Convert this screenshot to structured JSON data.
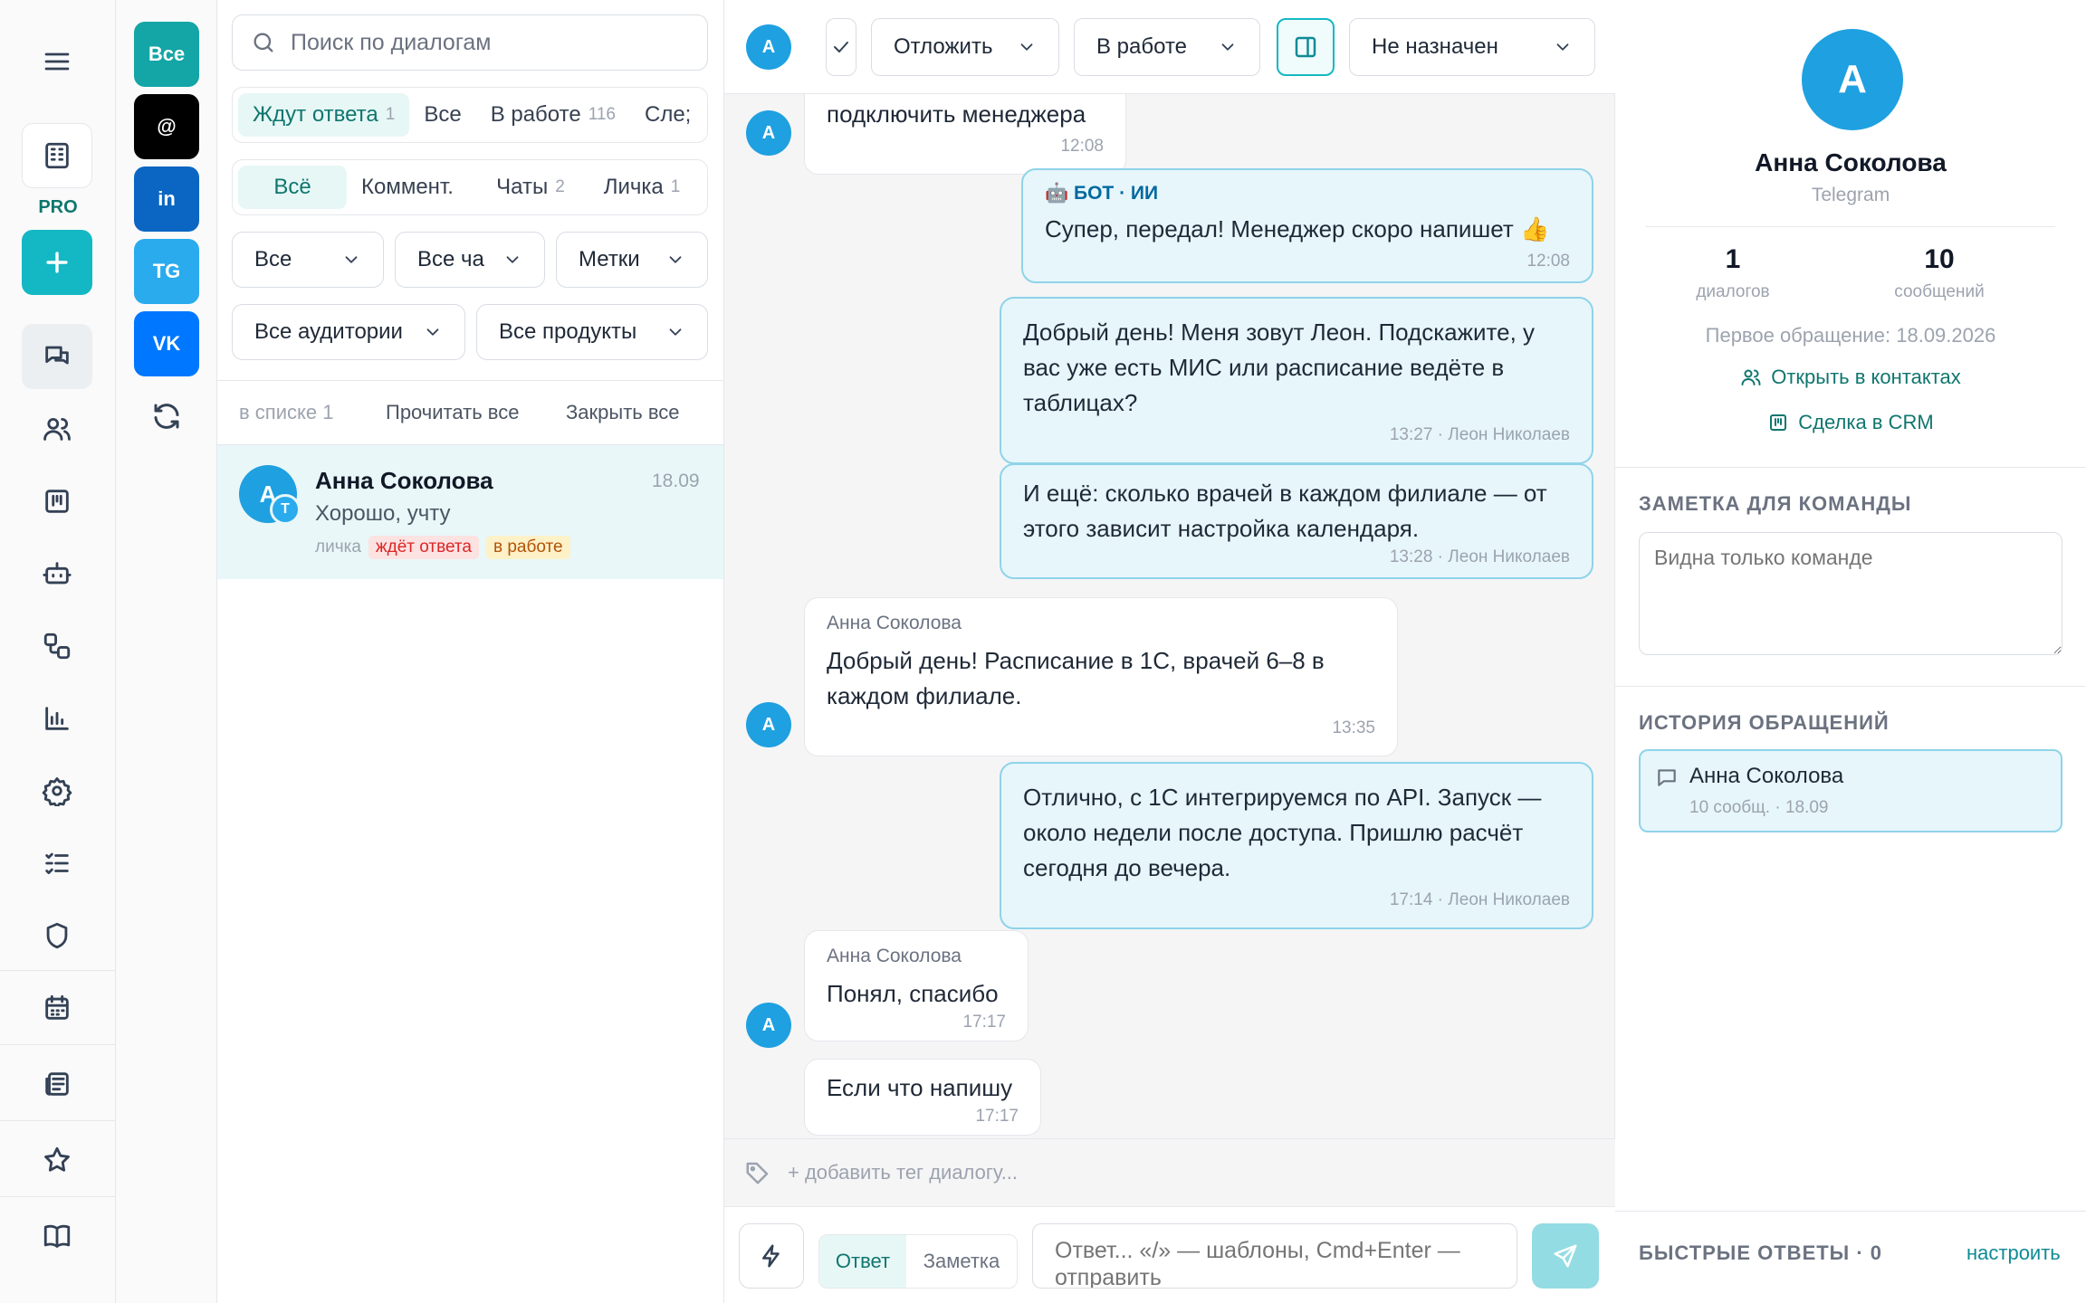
{
  "rail": {
    "plan_badge": "PRO",
    "icons": [
      "menu-icon",
      "building-icon",
      "plus-icon",
      "chat-icon",
      "users-icon",
      "kanban-icon",
      "bot-icon",
      "flow-icon",
      "chart-icon",
      "gear-icon",
      "checklist-icon",
      "shield-icon",
      "calendar-icon",
      "news-icon",
      "star-icon",
      "book-icon"
    ]
  },
  "channels": [
    {
      "label": "Все",
      "color": "#14a5a6"
    },
    {
      "label": "@",
      "color": "#000000"
    },
    {
      "label": "in",
      "color": "#0a66c2"
    },
    {
      "label": "TG",
      "color": "#2aabee"
    },
    {
      "label": "VK",
      "color": "#0077ff"
    }
  ],
  "list": {
    "search_placeholder": "Поиск по диалогам",
    "status_tabs": [
      {
        "label": "Ждут ответа",
        "count": "1"
      },
      {
        "label": "Все",
        "count": ""
      },
      {
        "label": "В работе",
        "count": "116"
      },
      {
        "label": "Сле;",
        "count": ""
      }
    ],
    "type_tabs": [
      {
        "label": "Всё",
        "count": ""
      },
      {
        "label": "Коммент.",
        "count": ""
      },
      {
        "label": "Чаты",
        "count": "2"
      },
      {
        "label": "Личка",
        "count": "1"
      }
    ],
    "filters": {
      "all": "Все",
      "all_channels": "Все ча",
      "tags": "Метки",
      "audiences": "Все аудитории",
      "products": "Все продукты"
    },
    "in_list": "в списке 1",
    "read_all": "Прочитать все",
    "close_all": "Закрыть все",
    "conversation": {
      "avatar": "А",
      "channel_badge": "T",
      "name": "Анна Соколова",
      "date": "18.09",
      "preview": "Хорошо, учту",
      "type": "личка",
      "tag_waiting": "ждёт ответа",
      "tag_work": "в работе"
    }
  },
  "chat": {
    "avatar": "А",
    "postpone": "Отложить",
    "status": "В работе",
    "assignee": "Не назначен",
    "messages": [
      {
        "dir": "in",
        "author": "",
        "text": "подключить менеджера",
        "time": "12:08"
      },
      {
        "dir": "out",
        "bot": "🤖 БОТ · ИИ",
        "text": "Супер, передал! Менеджер скоро напишет 👍",
        "time": "12:08"
      },
      {
        "dir": "out",
        "text": "Добрый день! Меня зовут Леон. Подскажите, у вас уже есть МИС или расписание ведёте в таблицах?",
        "time": "13:27 · Леон Николаев"
      },
      {
        "dir": "out",
        "text": "И ещё: сколько врачей в каждом филиале — от этого зависит настройка календаря.",
        "time": "13:28 · Леон Николаев"
      },
      {
        "dir": "in",
        "author": "Анна Соколова",
        "text": "Добрый день! Расписание в 1С, врачей 6–8 в каждом филиале.",
        "time": "13:35"
      },
      {
        "dir": "out",
        "text": "Отлично, с 1С интегрируемся по API. Запуск — около недели после доступа. Пришлю расчёт сегодня до вечера.",
        "time": "17:14 · Леон Николаев"
      },
      {
        "dir": "in",
        "author": "Анна Соколова",
        "text": "Понял, спасибо",
        "time": "17:17"
      },
      {
        "dir": "in",
        "author": "",
        "text": "Если что напишу",
        "time": "17:17"
      }
    ],
    "add_tag": "+ добавить тег диалогу...",
    "mode_reply": "Ответ",
    "mode_note": "Заметка",
    "input_placeholder": "Ответ... «/» — шаблоны, Cmd+Enter — отправить"
  },
  "contact": {
    "avatar": "А",
    "name": "Анна Соколова",
    "channel": "Telegram",
    "dialogs_count": "1",
    "dialogs_label": "диалогов",
    "messages_count": "10",
    "messages_label": "сообщений",
    "first_contact": "Первое обращение: 18.09.2026",
    "open_contacts": "Открыть в контактах",
    "crm_deal": "Сделка в CRM",
    "note_title": "ЗАМЕТКА ДЛЯ КОМАНДЫ",
    "note_placeholder": "Видна только команде",
    "history_title": "ИСТОРИЯ ОБРАЩЕНИЙ",
    "history_item": {
      "name": "Анна Соколова",
      "meta": "10 сообщ. · 18.09"
    },
    "quick_replies": "БЫСТРЫЕ ОТВЕТЫ · 0",
    "configure": "настроить"
  },
  "colors": {
    "accent": "#14b8c4",
    "teal": "#0f766e",
    "waiting_bg": "#fde2e2",
    "waiting_text": "#dc2626",
    "work_bg": "#fdf1c7",
    "work_text": "#b45309"
  }
}
